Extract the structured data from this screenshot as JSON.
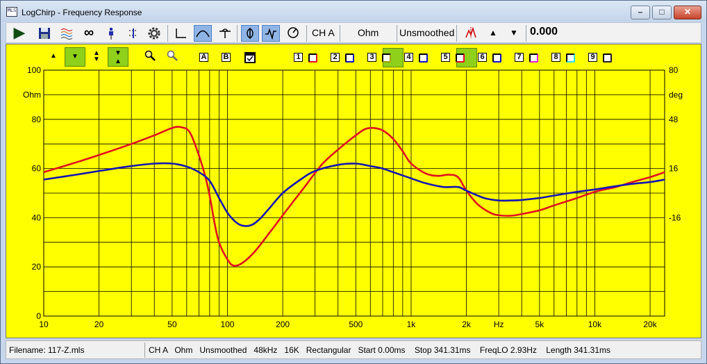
{
  "window": {
    "title": "LogChirp - Frequency Response",
    "icon_label": "MLS",
    "min_icon": "minimize-icon",
    "max_icon": "maximize-icon",
    "close_icon": "close-icon"
  },
  "toolbar": {
    "icons": [
      "play-icon",
      "save-icon",
      "waterfall-icon",
      "infinity-icon",
      "probe-icon",
      "calibrate-icon",
      "gear-icon",
      "impulse-icon",
      "frequency-response-icon",
      "step-response-icon",
      "phase-icon",
      "waveform-icon",
      "polar-icon"
    ],
    "channel_label": "CH A",
    "unit_label": "Ohm",
    "smoothing_label": "Unsmoothed",
    "marker_icon": "marker-icon",
    "up_icon": "up-arrow-icon",
    "down_icon": "down-arrow-icon",
    "value": "0.000"
  },
  "chart_controls": {
    "zoom_icons": [
      "triangle-up-icon",
      "triangle-down-icon",
      "expand-vertical-icon",
      "collapse-vertical-icon",
      "zoom-in-icon",
      "zoom-out-icon"
    ],
    "label_a": "A",
    "label_b": "B",
    "checkbox_icon": "checkbox-icon",
    "channels": [
      {
        "num": "1",
        "color": "#e01020",
        "highlight": false
      },
      {
        "num": "2",
        "color": "#1010c0",
        "highlight": false
      },
      {
        "num": "3",
        "color": "#a0a000",
        "highlight": true
      },
      {
        "num": "4",
        "color": "#1010c0",
        "highlight": false
      },
      {
        "num": "5",
        "color": "#e01020",
        "highlight": true
      },
      {
        "num": "6",
        "color": "#1010c0",
        "highlight": false
      },
      {
        "num": "7",
        "color": "#e020e0",
        "highlight": false
      },
      {
        "num": "8",
        "color": "#30e0e0",
        "highlight": false
      },
      {
        "num": "9",
        "color": "#202020",
        "highlight": false
      }
    ]
  },
  "chart_data": {
    "type": "line",
    "x_scale": "log",
    "xlim": [
      10,
      24000
    ],
    "ylim": [
      0,
      100
    ],
    "y2lim": [
      -80,
      80
    ],
    "x_ticks": [
      10,
      20,
      50,
      100,
      200,
      500,
      1000,
      2000,
      5000,
      10000,
      20000
    ],
    "x_tick_labels": [
      "10",
      "20",
      "50",
      "100",
      "200",
      "500",
      "1k",
      "2k",
      "5k",
      "10k",
      "20k"
    ],
    "x_unit": "Hz",
    "x_unit_pos": 3000,
    "y_ticks": [
      0,
      20,
      40,
      60,
      80,
      100
    ],
    "y_tick_labels": [
      "0",
      "20",
      "40",
      "60",
      "80",
      "100"
    ],
    "y_unit": "Ohm",
    "y2_ticks": [
      -16,
      16,
      48,
      80
    ],
    "y2_tick_labels": [
      "-16",
      "16",
      "48",
      "80"
    ],
    "y2_unit": "deg",
    "grid": true,
    "series": [
      {
        "color": "#e01020",
        "axis": "left",
        "x": [
          10,
          15,
          20,
          30,
          40,
          50,
          56,
          62,
          68,
          75,
          80,
          85,
          90,
          100,
          108,
          120,
          140,
          170,
          200,
          260,
          330,
          420,
          500,
          560,
          620,
          700,
          800,
          900,
          1000,
          1200,
          1400,
          1600,
          1800,
          2000,
          2300,
          2700,
          3000,
          3500,
          4000,
          5000,
          6000,
          8000,
          10000,
          13000,
          16000,
          20000,
          24000
        ],
        "y": [
          58.5,
          62.5,
          65.5,
          70,
          73.5,
          76.5,
          76.8,
          75,
          68,
          58,
          49,
          38,
          30,
          23,
          20.5,
          21.5,
          26,
          34,
          41,
          52,
          62,
          69,
          73.5,
          76,
          76.5,
          75.5,
          72,
          67,
          62,
          58,
          57,
          57.5,
          56.5,
          51,
          45.5,
          42,
          41,
          40.8,
          41.5,
          43,
          45,
          48,
          50.5,
          52.5,
          54.5,
          56.5,
          58.5
        ]
      },
      {
        "color": "#1515b5",
        "axis": "left",
        "x": [
          10,
          15,
          20,
          30,
          40,
          50,
          60,
          70,
          80,
          90,
          100,
          110,
          120,
          135,
          150,
          170,
          200,
          250,
          300,
          400,
          500,
          600,
          700,
          800,
          1000,
          1200,
          1500,
          1800,
          2000,
          2500,
          3000,
          3500,
          4000,
          5000,
          6000,
          8000,
          10000,
          15000,
          20000,
          24000
        ],
        "y": [
          55.5,
          57.5,
          59,
          61,
          62,
          62,
          60.8,
          58.5,
          55,
          48,
          42,
          38.5,
          36.8,
          37,
          39.5,
          44,
          50,
          55.5,
          59,
          61.5,
          62,
          61,
          60,
          58.5,
          56,
          54,
          52.5,
          52.5,
          51,
          48,
          47,
          47,
          47.2,
          48,
          49,
          50.5,
          51.5,
          53.5,
          54.5,
          55.5
        ]
      }
    ]
  },
  "status": {
    "left": "Filename: 117-Z.mls",
    "right": "CH A   Ohm   Unsmoothed   48kHz   16K   Rectangular   Start 0.00ms    Stop 341.31ms    FreqLO 2.93Hz    Length 341.31ms"
  }
}
